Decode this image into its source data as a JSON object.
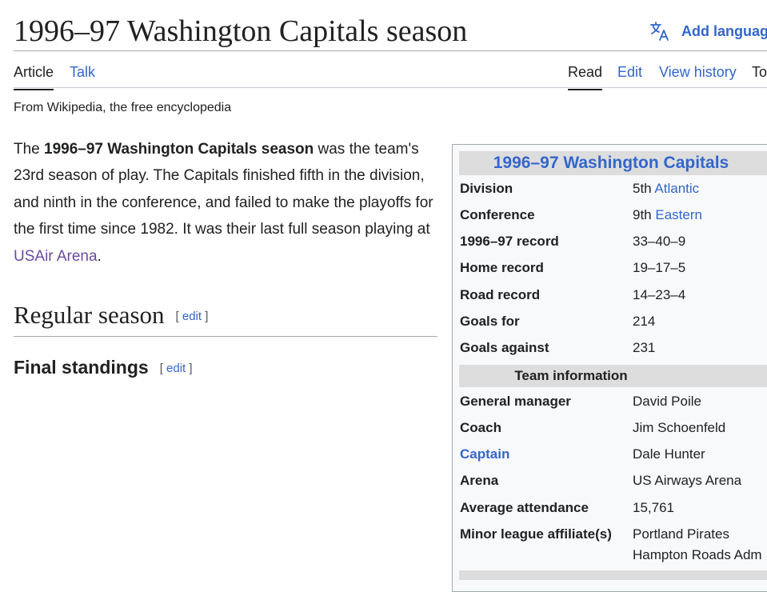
{
  "title": "1996–97 Washington Capitals season",
  "language_button": {
    "label": "Add languag",
    "icon": "translate-icon"
  },
  "tabs": {
    "left": [
      {
        "label": "Article",
        "active": true
      },
      {
        "label": "Talk",
        "active": false
      }
    ],
    "right": [
      {
        "label": "Read",
        "active": true
      },
      {
        "label": "Edit",
        "active": false
      },
      {
        "label": "View history",
        "active": false
      },
      {
        "label": "To",
        "active": false
      }
    ]
  },
  "tagline": "From Wikipedia, the free encyclopedia",
  "lead": {
    "p1": "The ",
    "bold": "1996–97 Washington Capitals season",
    "p2": " was the team's 23rd season of play. The Capitals finished fifth in the division, and ninth in the conference, and failed to make the playoffs for the first time since 1982. It was their last full season playing at ",
    "link": "USAir Arena",
    "p3": "."
  },
  "sections": {
    "regular_season": {
      "title": "Regular season",
      "edit_open": "[",
      "edit_label": "edit",
      "edit_close": "]"
    },
    "final_standings": {
      "title": "Final standings",
      "edit_open": "[",
      "edit_label": "edit",
      "edit_close": "]"
    }
  },
  "infobox": {
    "title": "1996–97 Washington Capitals",
    "rows": [
      {
        "label": "Division",
        "value_prefix": "5th ",
        "value_link": "Atlantic"
      },
      {
        "label": "Conference",
        "value_prefix": "9th ",
        "value_link": "Eastern"
      },
      {
        "label": "1996–97 record",
        "value": "33–40–9"
      },
      {
        "label": "Home record",
        "value": "19–17–5"
      },
      {
        "label": "Road record",
        "value": "14–23–4"
      },
      {
        "label": "Goals for",
        "value": "214"
      },
      {
        "label": "Goals against",
        "value": "231"
      }
    ],
    "team_header": "Team information",
    "team_rows": [
      {
        "label": "General manager",
        "value_link": "David Poile"
      },
      {
        "label": "Coach",
        "value_link": "Jim Schoenfeld"
      },
      {
        "label": "Captain",
        "value_link": "Dale Hunter"
      },
      {
        "label": "Arena",
        "value_link": "US Airways Arena"
      },
      {
        "label": "Average attendance",
        "value": "15,761"
      },
      {
        "label": "Minor league affiliate(s)",
        "value_link": "Portland Pirates",
        "value_link2": "Hampton Roads Adm"
      }
    ]
  },
  "colors": {
    "link": "#3366cc",
    "visited": "#6b4ba1",
    "text": "#202122",
    "infobox_bg": "#f8f9fa",
    "header_bg": "#dddddd"
  }
}
